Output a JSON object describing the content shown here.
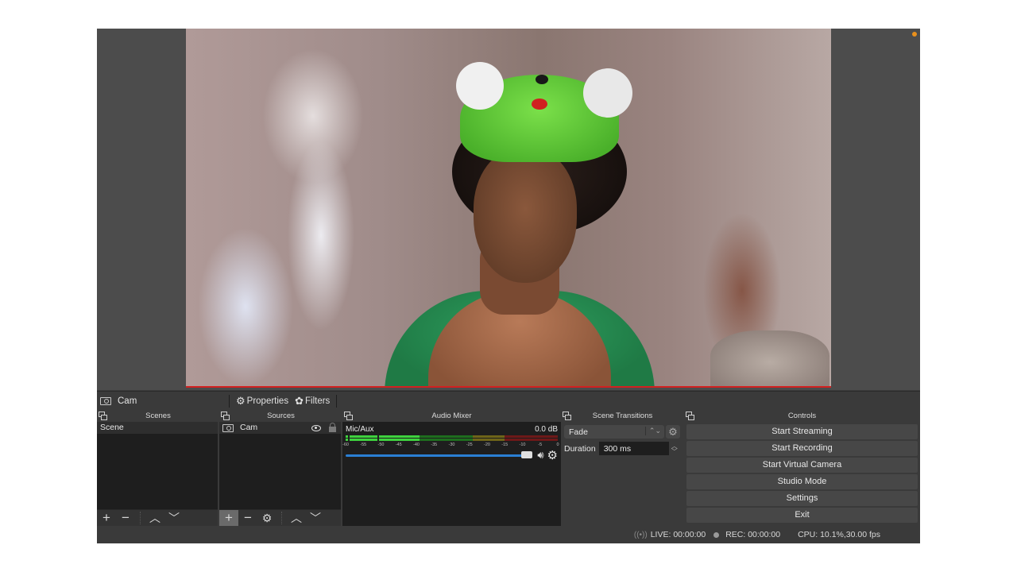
{
  "preview": {
    "recording_indicator_color": "#e8901c",
    "selection_border_color": "#d22020"
  },
  "context_bar": {
    "source_icon": "camera-icon",
    "source_name": "Cam",
    "properties_label": "Properties",
    "properties_icon": "gear-icon",
    "filters_label": "Filters",
    "filters_icon": "filters-icon"
  },
  "scenes": {
    "title": "Scenes",
    "items": [
      {
        "label": "Scene",
        "selected": true
      }
    ],
    "toolbar": [
      "add",
      "remove",
      "move-up",
      "move-down"
    ]
  },
  "sources": {
    "title": "Sources",
    "items": [
      {
        "label": "Cam",
        "icon": "camera-icon",
        "visible": true,
        "locked": false
      }
    ],
    "toolbar": [
      "add",
      "remove",
      "properties",
      "move-up",
      "move-down"
    ]
  },
  "audio_mixer": {
    "title": "Audio Mixer",
    "channels": [
      {
        "name": "Mic/Aux",
        "level": "0.0 dB",
        "volume_fraction": 1.0,
        "meter_ticks": [
          "-60",
          "-55",
          "-50",
          "-45",
          "-40",
          "-35",
          "-30",
          "-25",
          "-20",
          "-15",
          "-10",
          "-5",
          "0"
        ],
        "meter_colors": {
          "green": "#3ed23e",
          "yellow": "#c8b420",
          "red": "#c82424",
          "volume": "#2a7fd4"
        }
      }
    ]
  },
  "scene_transitions": {
    "title": "Scene Transitions",
    "transition": "Fade",
    "duration_label": "Duration",
    "duration_value": "300 ms"
  },
  "controls": {
    "title": "Controls",
    "buttons": [
      "Start Streaming",
      "Start Recording",
      "Start Virtual Camera",
      "Studio Mode",
      "Settings",
      "Exit"
    ]
  },
  "status_bar": {
    "live": "LIVE: 00:00:00",
    "rec": "REC: 00:00:00",
    "cpu": "CPU: 10.1%,30.00 fps"
  }
}
